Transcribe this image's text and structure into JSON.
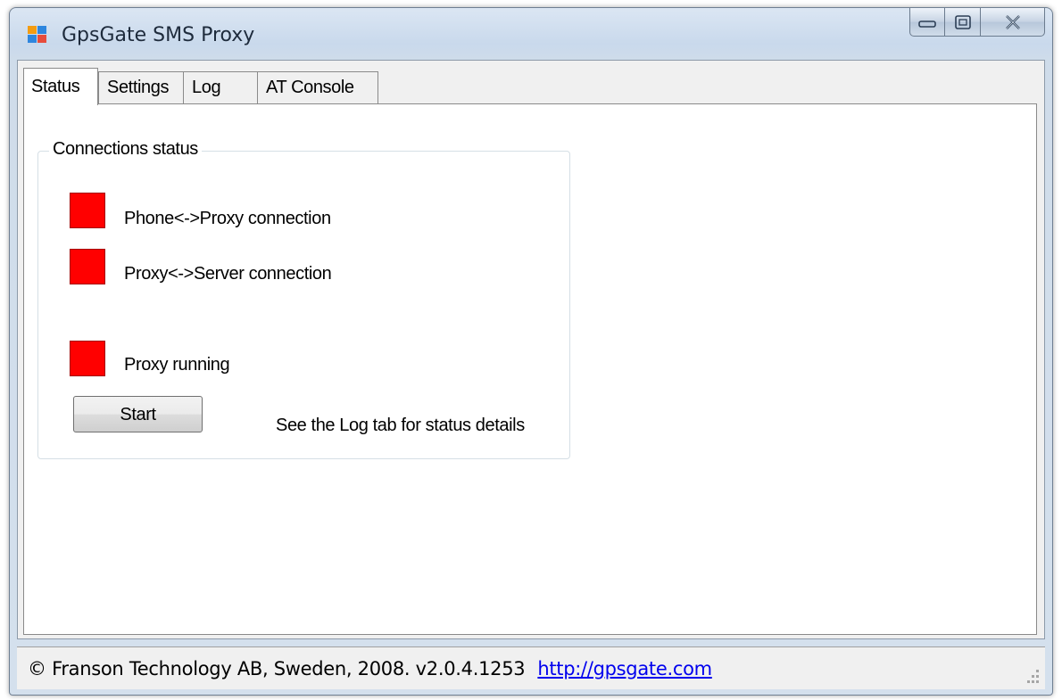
{
  "window": {
    "title": "GpsGate SMS Proxy",
    "caption_buttons": {
      "minimize": "minimize-icon",
      "maximize": "maximize-icon",
      "close": "close-icon"
    }
  },
  "tabs": [
    {
      "label": "Status",
      "active": true
    },
    {
      "label": "Settings",
      "active": false
    },
    {
      "label": "Log",
      "active": false
    },
    {
      "label": "AT Console",
      "active": false
    }
  ],
  "status_tab": {
    "group_title": "Connections status",
    "indicators": [
      {
        "label": "Phone<->Proxy connection",
        "color": "#ff0000"
      },
      {
        "label": "Proxy<->Server connection",
        "color": "#ff0000"
      },
      {
        "label": "Proxy running",
        "color": "#ff0000"
      }
    ],
    "start_button": "Start",
    "hint": "See the Log tab for status details"
  },
  "statusbar": {
    "copyright": "© Franson Technology AB, Sweden, 2008.  v2.0.4.1253",
    "link": "http://gpsgate.com"
  }
}
